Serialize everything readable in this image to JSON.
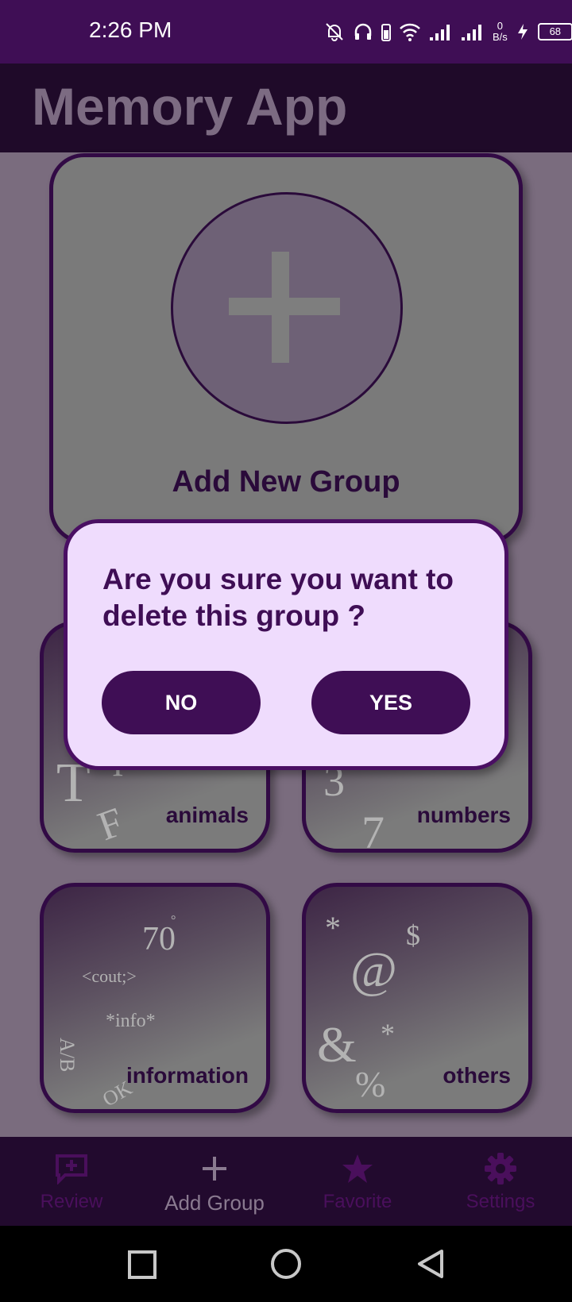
{
  "status_bar": {
    "time": "2:26 PM",
    "net_speed_value": "0",
    "net_speed_unit": "B/s",
    "battery": "68"
  },
  "app": {
    "title": "Memory App"
  },
  "add_card": {
    "label": "Add New Group"
  },
  "groups": [
    {
      "label": "animals",
      "deco": [
        "T",
        "I",
        "F"
      ]
    },
    {
      "label": "numbers",
      "deco": [
        "3",
        "7"
      ]
    },
    {
      "label": "information",
      "deco": [
        "70",
        "°",
        "<cout;>",
        "*info*",
        "A/B",
        "OK"
      ]
    },
    {
      "label": "others",
      "deco": [
        "*",
        "$",
        "@",
        "&",
        "*",
        "%"
      ]
    }
  ],
  "dialog": {
    "message": "Are you sure you want to delete this group ?",
    "no_label": "NO",
    "yes_label": "YES"
  },
  "bottom_nav": [
    {
      "label": "Review",
      "icon": "add-comment-icon",
      "color": "#4a0f5c"
    },
    {
      "label": "Add Group",
      "icon": "plus-icon",
      "color": "#8a7a90",
      "active": true
    },
    {
      "label": "Favorite",
      "icon": "star-icon",
      "color": "#4a0f5c"
    },
    {
      "label": "Settings",
      "icon": "gear-icon",
      "color": "#4a0f5c"
    }
  ],
  "colors": {
    "status_bar": "#3f0e55",
    "accent": "#3f0e55",
    "dialog_bg": "#efdcfd"
  }
}
